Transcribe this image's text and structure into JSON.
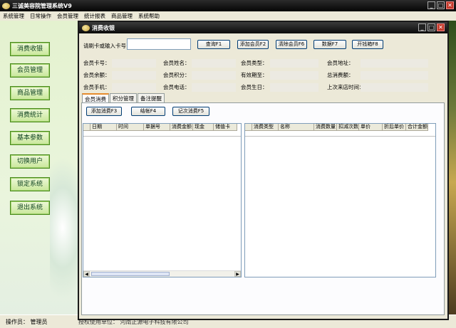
{
  "main_window": {
    "title": "三诚美容院管理系统V9",
    "menu": [
      "系统管理",
      "日常操作",
      "会员管理",
      "统计报表",
      "商品管理",
      "系统帮助"
    ],
    "sidebar": [
      "消费收银",
      "会员管理",
      "商品管理",
      "消费统计",
      "基本参数",
      "切换用户",
      "锁定系统",
      "退出系统"
    ],
    "status": {
      "operator": "操作员：  管理员",
      "unit": "授权使用单位：  河南正源电子科技有限公司"
    }
  },
  "window_controls": {
    "minimize": "_",
    "maximize": "□",
    "close": "✕"
  },
  "child_window": {
    "title": "消费收银",
    "search": {
      "label": "请刷卡或输入卡号",
      "value": "",
      "placeholder": ""
    },
    "buttons": [
      "查询F1",
      "添加会员F2",
      "清除会员F6",
      "数据F7",
      "开钱箱F8"
    ],
    "member_fields": [
      [
        "会员卡号：",
        "会员姓名：",
        "会员类型：",
        "会员地址："
      ],
      [
        "会员余额：",
        "会员积分：",
        "有效期至：",
        "总消费额："
      ],
      [
        "会员手机：",
        "会员电话：",
        "会员生日：",
        "上次来店时间："
      ]
    ],
    "tabs": [
      "会员消费",
      "积分管理",
      "备注提醒"
    ],
    "action_buttons": [
      "添加消费F3",
      "结帐F4",
      "记次消费F5"
    ],
    "left_grid_columns": [
      "日期",
      "时间",
      "单据号",
      "消费金额",
      "现金",
      "储值卡"
    ],
    "right_grid_columns": [
      "消费类型",
      "名称",
      "消费数量",
      "扣减次数",
      "单价",
      "折后单价",
      "合计金额"
    ]
  },
  "colors": {
    "title_bar": "#0a0a0a",
    "sidebar_green": "#c8e79a",
    "tab_accent": "#e68b2c"
  }
}
